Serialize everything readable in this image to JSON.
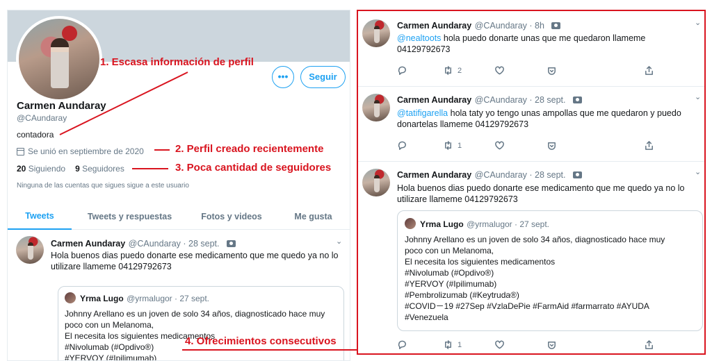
{
  "profile": {
    "name": "Carmen Aundaray",
    "handle": "@CAundaray",
    "bio": "contadora",
    "joined": "Se unió en septiembre de 2020",
    "following_count": "20",
    "following_label": "Siguiendo",
    "followers_count": "9",
    "followers_label": "Seguidores",
    "followers_note": "Ninguna de las cuentas que sigues sigue a este usuario",
    "more_label": "•••",
    "follow_label": "Seguir"
  },
  "tabs": [
    "Tweets",
    "Tweets y respuestas",
    "Fotos y videos",
    "Me gusta"
  ],
  "left_tweet": {
    "name": "Carmen Aundaray",
    "meta": "@CAundaray · 28 sept.",
    "text1": "Hola buenos dias puedo donarte ese medicamento que me quedo ya no lo",
    "text2": "utilizare llameme 04129792673",
    "quote_name": "Yrma Lugo",
    "quote_meta": "@yrmalugor · 27 sept.",
    "quote_lines": [
      "Johnny Arellano es un joven de solo 34 años, diagnosticado hace muy",
      "poco con un Melanoma,",
      "El necesita los siguientes medicamentos",
      "#Nivolumab (#Opdivo®)",
      "#YERVOY (#Ipilimumab)"
    ]
  },
  "right_tweets": [
    {
      "name": "Carmen Aundaray",
      "meta": "@CAundaray · 8h",
      "mention": "@nealtoots",
      "text1": " hola puedo donarte unas que me quedaron llameme",
      "text2": "04129792673",
      "retweets": "2",
      "replies": ""
    },
    {
      "name": "Carmen Aundaray",
      "meta": "@CAundaray · 28 sept.",
      "mention": "@tatifigarella",
      "text1": " hola taty yo tengo unas ampollas que me quedaron y puedo",
      "text2": "donartelas llameme 04129792673",
      "retweets": "1",
      "replies": ""
    },
    {
      "name": "Carmen Aundaray",
      "meta": "@CAundaray · 28 sept.",
      "mention": "",
      "text1": "Hola buenos dias puedo donarte ese medicamento que me quedo ya no lo",
      "text2": "utilizare llameme 04129792673",
      "retweets": "1",
      "replies": ""
    }
  ],
  "right_quote": {
    "name": "Yrma Lugo",
    "meta": "@yrmalugor · 27 sept.",
    "lines": [
      "Johnny Arellano es un joven de solo 34 años, diagnosticado hace muy",
      "poco con un Melanoma,",
      "El necesita los siguientes medicamentos",
      "#Nivolumab (#Opdivo®)",
      "#YERVOY (#Ipilimumab)",
      "#Pembrolizumab (#Keytruda®)",
      "#COVID－19 #27Sep #VzlaDePie #FarmAid #farmarrato #AYUDA",
      "#Venezuela"
    ]
  },
  "annotations": {
    "a1": "1. Escasa información de perfil",
    "a2": "2. Perfil creado recientemente",
    "a3": "3. Poca cantidad de seguidores",
    "a4": "4. Ofrecimientos consecutivos"
  },
  "colors": {
    "accent": "#1da1f2",
    "annotation": "#d9141f",
    "banner": "#ccd6dd"
  }
}
